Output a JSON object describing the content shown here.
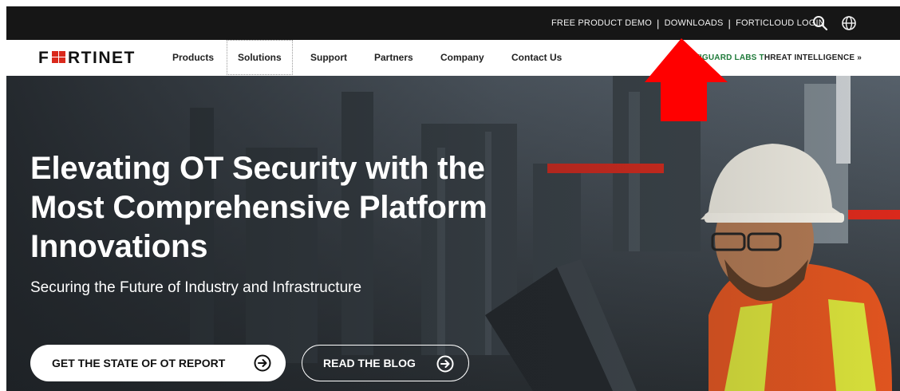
{
  "topbar": {
    "links": [
      "FREE PRODUCT DEMO",
      "DOWNLOADS",
      "FORTICLOUD LOGIN"
    ],
    "separator": "|",
    "icons": [
      "search-icon",
      "globe-icon"
    ]
  },
  "nav": {
    "logo_text": "FORTINET",
    "items": [
      "Products",
      "Solutions",
      "Support",
      "Partners",
      "Company",
      "Contact Us"
    ],
    "active_item": "Solutions",
    "fortiguard_prefix": "FORTIGUARD LABS T",
    "fortiguard_suffix": "HREAT INTELLIGENCE »"
  },
  "hero": {
    "headline": "Elevating OT Security with the Most Comprehensive Platform Innovations",
    "subhead": "Securing the Future of Industry and Infrastructure",
    "primary_cta": "GET THE STATE OF OT REPORT",
    "secondary_cta": "READ THE BLOG"
  },
  "colors": {
    "topbar_bg": "#161616",
    "accent_red": "#da291c",
    "fortiguard_green": "#1f7a3a",
    "annotation_red": "#ff0000"
  }
}
